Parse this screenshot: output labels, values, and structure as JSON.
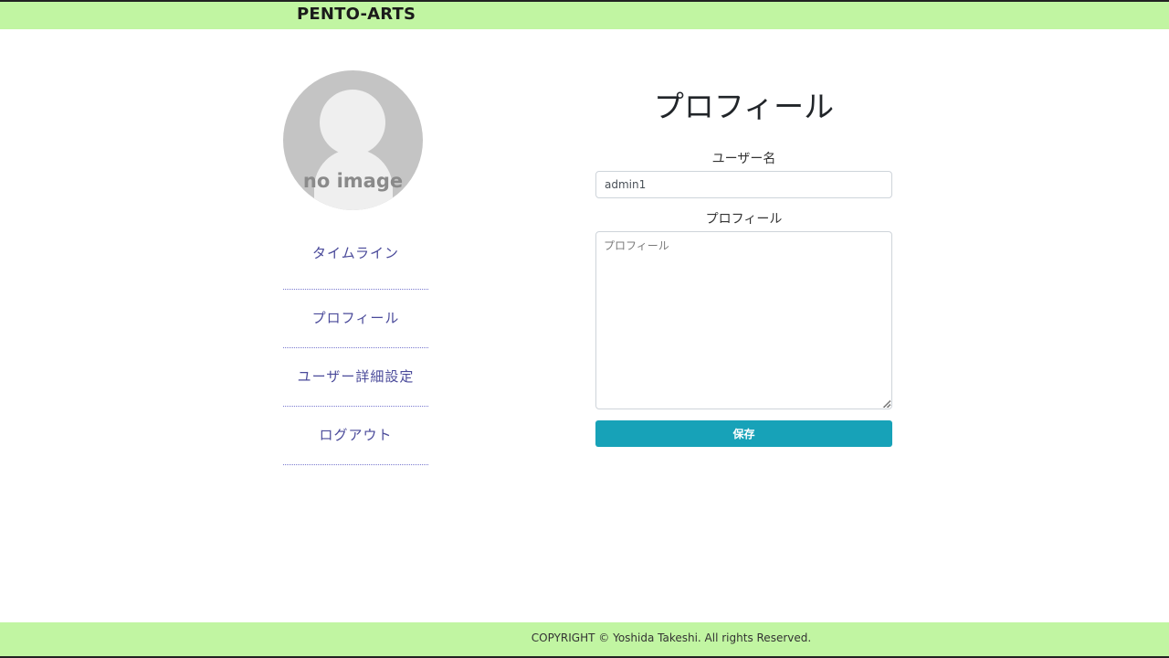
{
  "header": {
    "brand": "PENTO-ARTS",
    "accent_color": "#c1f5a2"
  },
  "avatar": {
    "icon": "user-silhouette-icon",
    "text": "no image"
  },
  "sidebar": {
    "items": [
      {
        "label": "タイムライン"
      },
      {
        "label": "プロフィール"
      },
      {
        "label": "ユーザー詳細設定"
      },
      {
        "label": "ログアウト"
      }
    ]
  },
  "main": {
    "title": "プロフィール",
    "username_label": "ユーザー名",
    "username_value": "admin1",
    "profile_label": "プロフィール",
    "profile_placeholder": "プロフィール",
    "save_label": "保存",
    "save_color": "#17a2b8"
  },
  "footer": {
    "copyright": "COPYRIGHT © Yoshida Takeshi. All rights Reserved."
  }
}
